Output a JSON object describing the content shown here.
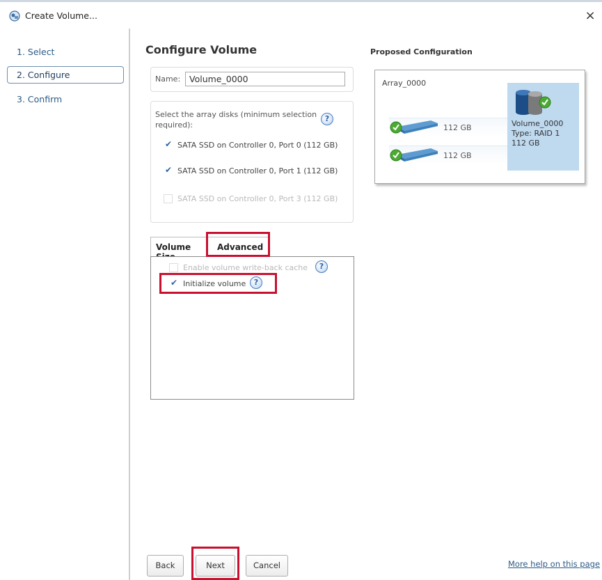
{
  "window": {
    "title": "Create Volume...",
    "close_label": "×"
  },
  "sidebar": {
    "items": [
      {
        "label": "1. Select"
      },
      {
        "label": "2. Configure"
      },
      {
        "label": "3. Confirm"
      }
    ],
    "active_index": 1
  },
  "main": {
    "title": "Configure Volume",
    "name_label": "Name:",
    "name_value": "Volume_0000",
    "disks_header": "Select the array disks (minimum selection required):",
    "disks": [
      {
        "label": "SATA SSD on Controller 0, Port 0 (112 GB)",
        "checked": true,
        "enabled": true
      },
      {
        "label": "SATA SSD on Controller 0, Port 1 (112 GB)",
        "checked": true,
        "enabled": true
      },
      {
        "label": "SATA SSD on Controller 0, Port 3 (112 GB)",
        "checked": false,
        "enabled": false
      }
    ],
    "tabs": [
      {
        "label": "Volume Size"
      },
      {
        "label": "Advanced"
      }
    ],
    "active_tab": "Advanced",
    "advanced_options": [
      {
        "label": "Enable volume write-back cache",
        "checked": false,
        "enabled": false
      },
      {
        "label": "Initialize volume",
        "checked": true,
        "enabled": true
      }
    ]
  },
  "proposed": {
    "title": "Proposed Configuration",
    "array_name": "Array_0000",
    "disks": [
      {
        "size": "112 GB"
      },
      {
        "size": "112 GB"
      }
    ],
    "volume": {
      "name": "Volume_0000",
      "type": "Type: RAID 1",
      "size": "112 GB"
    }
  },
  "footer": {
    "back_label": "Back",
    "next_label": "Next",
    "cancel_label": "Cancel",
    "help_link": "More help on this page"
  },
  "colors": {
    "highlight": "#c8102e",
    "link": "#2c5a86",
    "volume_panel": "#bfd9ef"
  },
  "icons": {
    "help": "?",
    "check": "✔"
  }
}
